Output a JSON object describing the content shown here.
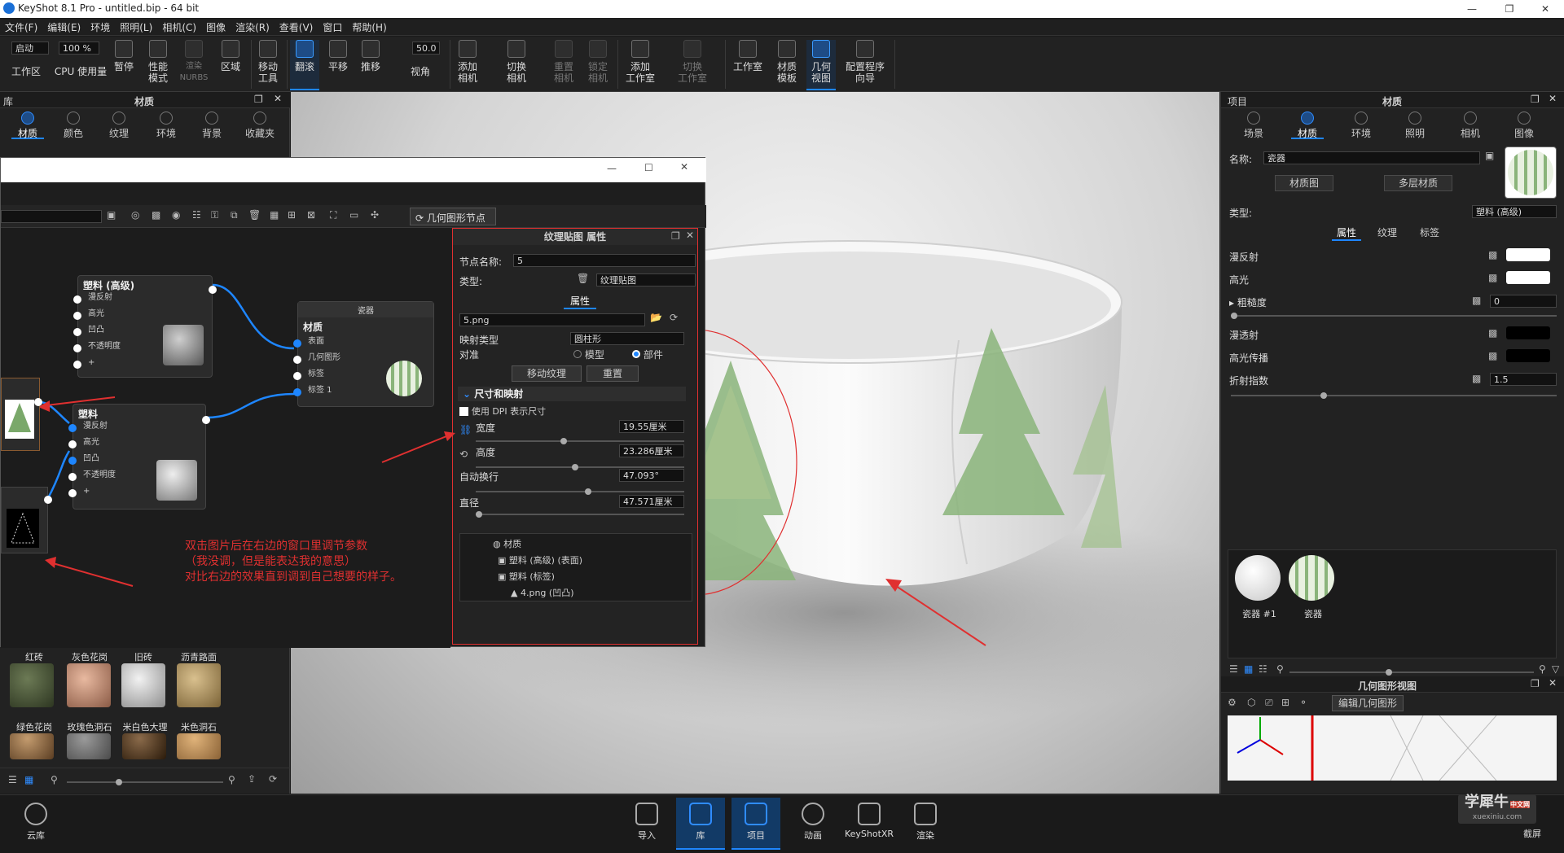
{
  "window": {
    "title": "KeyShot 8.1 Pro  - untitled.bip  - 64 bit"
  },
  "menu": [
    "文件(F)",
    "编辑(E)",
    "环境",
    "照明(L)",
    "相机(C)",
    "图像",
    "渲染(R)",
    "查看(V)",
    "窗口",
    "帮助(H)"
  ],
  "toolbar": {
    "workspace_select": "启动",
    "cpu_value": "100 %",
    "fov_value": "50.0",
    "items": [
      {
        "label": "工作区",
        "icon": "workspace-icon"
      },
      {
        "label": "CPU 使用量",
        "icon": "cpu-icon"
      },
      {
        "label": "暂停",
        "icon": "pause-icon"
      },
      {
        "label": "性能\n模式",
        "icon": "performance-icon"
      },
      {
        "label": "渲染\nNURBS",
        "icon": "nurbs-icon"
      },
      {
        "label": "区域",
        "icon": "region-icon"
      },
      {
        "label": "移动\n工具",
        "icon": "move-tool-icon"
      },
      {
        "label": "翻滚",
        "icon": "tumble-icon"
      },
      {
        "label": "平移",
        "icon": "pan-icon"
      },
      {
        "label": "推移",
        "icon": "dolly-icon"
      },
      {
        "label": "视角",
        "icon": "fov-icon"
      },
      {
        "label": "添加\n相机",
        "icon": "add-camera-icon"
      },
      {
        "label": "切换\n相机",
        "icon": "switch-camera-icon"
      },
      {
        "label": "重置\n相机",
        "icon": "reset-camera-icon"
      },
      {
        "label": "锁定\n相机",
        "icon": "lock-camera-icon"
      },
      {
        "label": "添加\n工作室",
        "icon": "add-studio-icon"
      },
      {
        "label": "切换\n工作室",
        "icon": "switch-studio-icon"
      },
      {
        "label": "工作室",
        "icon": "studio-icon"
      },
      {
        "label": "材质\n模板",
        "icon": "material-template-icon"
      },
      {
        "label": "几何\n视图",
        "icon": "geometry-view-icon"
      },
      {
        "label": "配置程序\n向导",
        "icon": "configurator-icon"
      }
    ]
  },
  "library": {
    "header_left": "库",
    "header_title": "材质",
    "tabs": [
      "材质",
      "颜色",
      "纹理",
      "环境",
      "背景",
      "收藏夹"
    ],
    "swatches_row1": [
      "红砖",
      "灰色花岗",
      "旧砖",
      "沥青路面"
    ],
    "swatches_row2": [
      "绿色花岗",
      "玫瑰色洞石",
      "米白色大理",
      "米色洞石"
    ]
  },
  "node_editor": {
    "geometry_node_button": "几何图形节点",
    "nodes": {
      "plastic_adv": {
        "title": "塑料 (高级)",
        "rows": [
          "漫反射",
          "高光",
          "凹凸",
          "不透明度",
          "+"
        ]
      },
      "material": {
        "header": "瓷器",
        "title": "材质",
        "rows": [
          "表面",
          "几何图形",
          "标签",
          "标签 1"
        ]
      },
      "plastic": {
        "title": "塑料",
        "rows": [
          "漫反射",
          "高光",
          "凹凸",
          "不透明度",
          "+"
        ]
      }
    },
    "annotation": [
      "双击图片后在右边的窗口里调节参数",
      "（我没调，但是能表达我的意思）",
      "对比右边的效果直到调到自己想要的样子。"
    ]
  },
  "texture_props": {
    "title": "纹理贴图 属性",
    "node_name_label": "节点名称:",
    "node_name_value": "5",
    "type_label": "类型:",
    "type_value": "纹理贴图",
    "tab": "属性",
    "file": "5.png",
    "mapping_label": "映射类型",
    "mapping_value": "圆柱形",
    "align_label": "对准",
    "align_model": "模型",
    "align_part": "部件",
    "move_texture": "移动纹理",
    "reset": "重置",
    "section": "尺寸和映射",
    "dpi_label": "使用 DPI 表示尺寸",
    "width_label": "宽度",
    "width_value": "19.55厘米",
    "height_label": "高度",
    "height_value": "23.286厘米",
    "wrap_label": "自动换行",
    "wrap_value": "47.093°",
    "diameter_label": "直径",
    "diameter_value": "47.571厘米",
    "tree": [
      "材质",
      "塑料 (高级) (表面)",
      "塑料 (标签)",
      "4.png (凹凸)"
    ]
  },
  "project": {
    "header_left": "项目",
    "header_title": "材质",
    "tabs": [
      "场景",
      "材质",
      "环境",
      "照明",
      "相机",
      "图像"
    ],
    "name_label": "名称:",
    "name_value": "瓷器",
    "material_graph": "材质图",
    "multi_material": "多层材质",
    "type_label": "类型:",
    "type_value": "塑料 (高级)",
    "subtabs": [
      "属性",
      "纹理",
      "标签"
    ],
    "props": [
      {
        "label": "漫反射",
        "value": ""
      },
      {
        "label": "高光",
        "value": ""
      },
      {
        "label": "粗糙度",
        "value": "0"
      },
      {
        "label": "漫透射",
        "value": ""
      },
      {
        "label": "高光传播",
        "value": ""
      },
      {
        "label": "折射指数",
        "value": "1.5"
      }
    ],
    "thumbs": [
      "瓷器 #1",
      "瓷器"
    ]
  },
  "geometry_view": {
    "title": "几何图形视图",
    "edit_button": "编辑几何图形"
  },
  "bottom": {
    "cloud": "云库",
    "buttons": [
      "导入",
      "库",
      "项目",
      "动画",
      "KeyShotXR",
      "渲染"
    ],
    "screenshot": "截屏",
    "watermark": "学犀牛",
    "watermark_sub": "xuexiniu.com",
    "watermark_tag": "中文网"
  },
  "colors": {
    "accent": "#1e86ff",
    "annotation": "#e03030"
  }
}
